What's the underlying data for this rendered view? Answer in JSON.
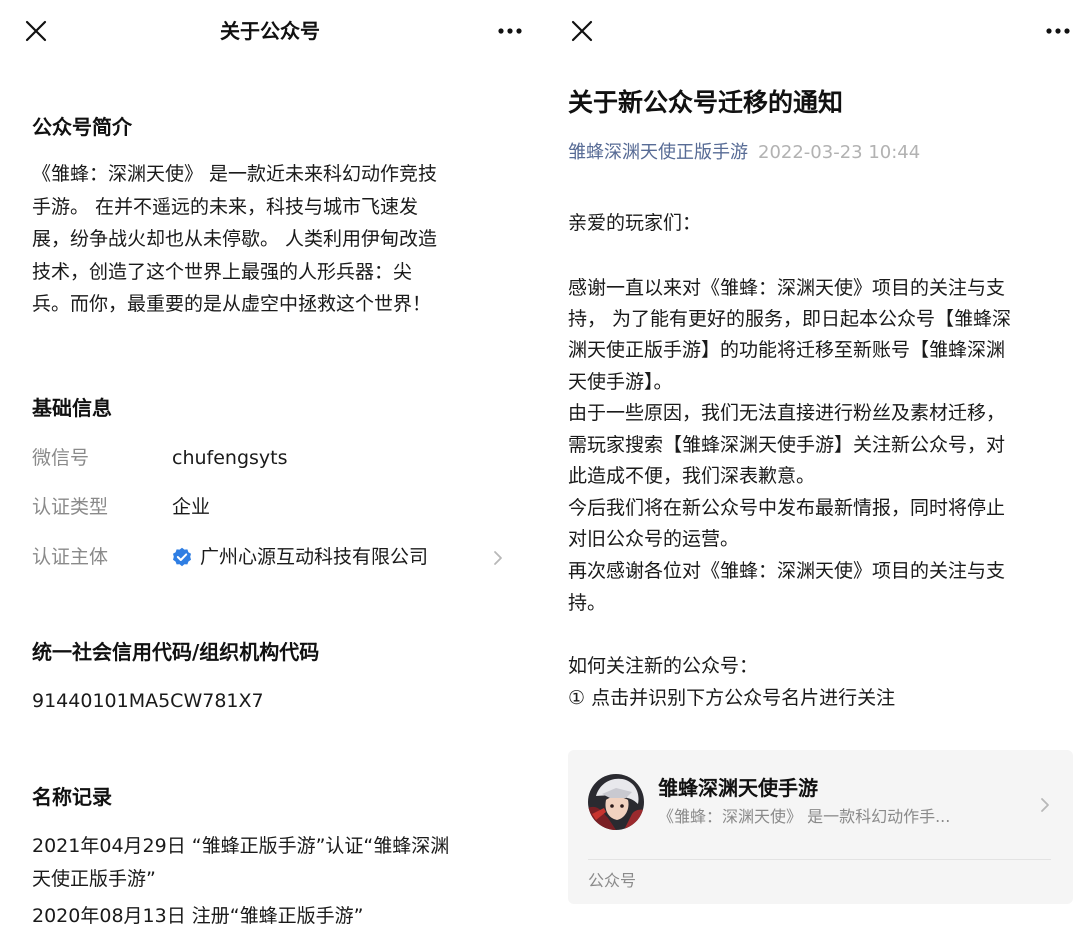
{
  "left": {
    "nav_title": "关于公众号",
    "intro_title": "公众号简介",
    "intro_lines": [
      "《雏蜂：深渊天使》 是一款近未来科幻动作竞技",
      "手游。 在并不遥远的未来，科技与城市飞速发",
      "展，纷争战火却也从未停歇。 人类利用伊甸改造",
      "技术，创造了这个世界上最强的人形兵器：尖",
      "兵。而你，最重要的是从虚空中拯救这个世界！"
    ],
    "basic_title": "基础信息",
    "basic_rows": [
      {
        "label": "微信号",
        "value": "chufengsyts"
      },
      {
        "label": "认证类型",
        "value": "企业"
      },
      {
        "label": "认证主体",
        "value": "广州心源互动科技有限公司"
      }
    ],
    "credit_title": "统一社会信用代码/组织机构代码",
    "credit_code": "91440101MA5CW781X7",
    "history_title": "名称记录",
    "history_lines": [
      "2021年04月29日 “雏蜂正版手游”认证“雏蜂深渊",
      "天使正版手游”",
      "2020年08月13日 注册“雏蜂正版手游”"
    ]
  },
  "right": {
    "article_title": "关于新公众号迁移的通知",
    "account_name": "雏蜂深渊天使正版手游",
    "date": "2022-03-23 10:44",
    "body_lines": [
      "亲爱的玩家们：",
      "",
      "感谢一直以来对《雏蜂：深渊天使》项目的关注与支",
      "持， 为了能有更好的服务，即日起本公众号【雏蜂深",
      "渊天使正版手游】的功能将迁移至新账号【雏蜂深渊",
      "天使手游】。",
      "由于一些原因，我们无法直接进行粉丝及素材迁移，",
      "需玩家搜索【雏蜂深渊天使手游】关注新公众号，对",
      "此造成不便，我们深表歉意。",
      "今后我们将在新公众号中发布最新情报，同时将停止",
      "对旧公众号的运营。",
      "再次感谢各位对《雏蜂：深渊天使》项目的关注与支",
      "持。",
      "",
      "如何关注新的公众号：",
      "①  点击并识别下方公众号名片进行关注"
    ],
    "card": {
      "name": "雏蜂深渊天使手游",
      "desc": "《雏蜂：深渊天使》 是一款科幻动作手...",
      "type_label": "公众号"
    }
  },
  "icons": {
    "close": "close-icon",
    "more": "more-icon",
    "verified": "verified-badge-icon",
    "chevron": "chevron-right-icon",
    "avatar": "avatar"
  },
  "colors": {
    "link_blue": "#576b95",
    "verified_blue": "#2f7ee3",
    "meta_gray": "#b2b2b2",
    "label_gray": "#8a8a8a",
    "card_bg": "#f5f5f5"
  }
}
